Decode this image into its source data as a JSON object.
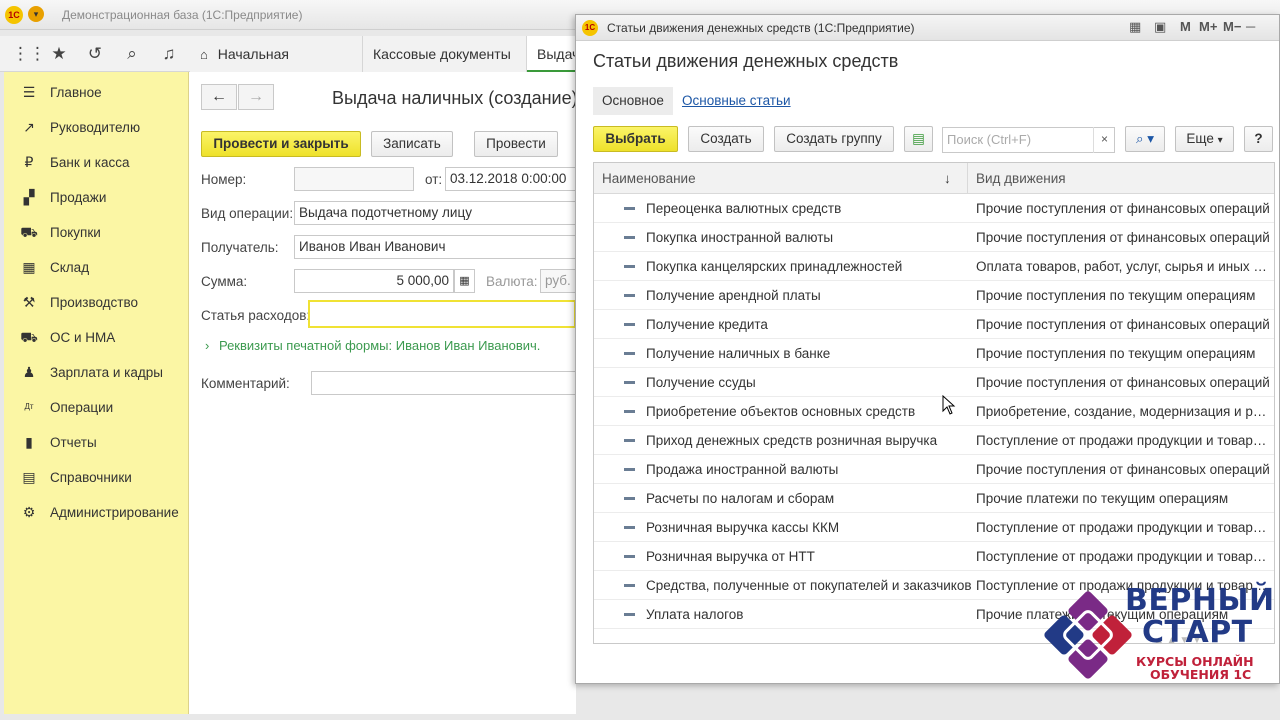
{
  "app": {
    "title": "Демонстрационная база  (1С:Предприятие)",
    "logo": "1С"
  },
  "navbar": {
    "tabs": [
      {
        "label": "Начальная страница",
        "icon": "home-icon"
      },
      {
        "label": "Кассовые документы",
        "close": "×"
      },
      {
        "label": "Выдача"
      }
    ]
  },
  "sidebar": {
    "items": [
      {
        "label": "Главное",
        "icon": "menu-lines-icon",
        "glyph": "☰"
      },
      {
        "label": "Руководителю",
        "icon": "trend-icon",
        "glyph": "↗"
      },
      {
        "label": "Банк и касса",
        "icon": "ruble-icon",
        "glyph": "₽"
      },
      {
        "label": "Продажи",
        "icon": "sales-icon",
        "glyph": "▞"
      },
      {
        "label": "Покупки",
        "icon": "cart-icon",
        "glyph": "⛟"
      },
      {
        "label": "Склад",
        "icon": "warehouse-icon",
        "glyph": "▦"
      },
      {
        "label": "Производство",
        "icon": "factory-icon",
        "glyph": "⚒"
      },
      {
        "label": "ОС и НМА",
        "icon": "truck-icon",
        "glyph": "⛟"
      },
      {
        "label": "Зарплата и кадры",
        "icon": "person-icon",
        "glyph": "♟"
      },
      {
        "label": "Операции",
        "icon": "dt-kt-icon",
        "glyph": "Дт"
      },
      {
        "label": "Отчеты",
        "icon": "bar-chart-icon",
        "glyph": "▮"
      },
      {
        "label": "Справочники",
        "icon": "book-icon",
        "glyph": "▤"
      },
      {
        "label": "Администрирование",
        "icon": "gear-icon",
        "glyph": "⚙"
      }
    ]
  },
  "form": {
    "title": "Выдача наличных (создание)",
    "buttons": {
      "post_close": "Провести и закрыть",
      "save": "Записать",
      "post": "Провести"
    },
    "number_label": "Номер:",
    "number_value": "",
    "date_label": "от:",
    "date_value": "03.12.2018  0:00:00",
    "operation_label": "Вид операции:",
    "operation_value": "Выдача подотчетному лицу",
    "recipient_label": "Получатель:",
    "recipient_value": "Иванов Иван Иванович",
    "amount_label": "Сумма:",
    "amount_value": "5 000,00",
    "currency_label": "Валюта:",
    "currency_value": "руб.",
    "expense_label": "Статья расходов:",
    "expense_value": "",
    "print_link": "Реквизиты печатной формы: Иванов Иван Иванович.",
    "comment_label": "Комментарий:",
    "comment_value": ""
  },
  "dialog": {
    "window_title": "Статьи движения денежных средств  (1С:Предприятие)",
    "heading": "Статьи движения денежных средств",
    "tabs": {
      "main": "Основное",
      "main_items": "Основные статьи"
    },
    "buttons": {
      "select": "Выбрать",
      "create": "Создать",
      "create_group": "Создать группу",
      "more": "Еще",
      "help": "?"
    },
    "search_placeholder": "Поиск (Ctrl+F)",
    "columns": {
      "name": "Наименование",
      "sort": "↓",
      "kind": "Вид движения"
    },
    "rows": [
      {
        "name": "Переоценка валютных средств",
        "kind": "Прочие поступления от финансовых операций"
      },
      {
        "name": "Покупка иностранной валюты",
        "kind": "Прочие поступления от финансовых операций"
      },
      {
        "name": "Покупка канцелярских принадлежностей",
        "kind": "Оплата товаров, работ, услуг, сырья и иных о..."
      },
      {
        "name": "Получение арендной платы",
        "kind": "Прочие поступления по текущим операциям"
      },
      {
        "name": "Получение кредита",
        "kind": "Прочие поступления от финансовых операций"
      },
      {
        "name": "Получение наличных в банке",
        "kind": "Прочие поступления по текущим операциям"
      },
      {
        "name": "Получение ссуды",
        "kind": "Прочие поступления от финансовых операций"
      },
      {
        "name": "Приобретение объектов основных средств",
        "kind": "Приобретение, создание, модернизация и рек..."
      },
      {
        "name": "Приход денежных средств розничная выручка",
        "kind": "Поступление от продажи продукции и товаров..."
      },
      {
        "name": "Продажа иностранной валюты",
        "kind": "Прочие поступления от финансовых операций"
      },
      {
        "name": "Расчеты по налогам и сборам",
        "kind": "Прочие платежи по текущим операциям"
      },
      {
        "name": "Розничная выручка кассы ККМ",
        "kind": "Поступление от продажи продукции и товаров..."
      },
      {
        "name": "Розничная выручка от НТТ",
        "kind": "Поступление от продажи продукции и товаров..."
      },
      {
        "name": "Средства, полученные от покупателей и заказчиков",
        "kind": "Поступление от продажи продукции и товаров..."
      },
      {
        "name": "Уплата налогов",
        "kind": "Прочие платежи по текущим операциям"
      }
    ]
  },
  "watermark": {
    "line1": "ВЕРНЫЙ",
    "line2": "СТАРТ",
    "line3": "КУРСЫ ОНЛАЙН",
    "line4": "ОБУЧЕНИЯ 1С"
  }
}
